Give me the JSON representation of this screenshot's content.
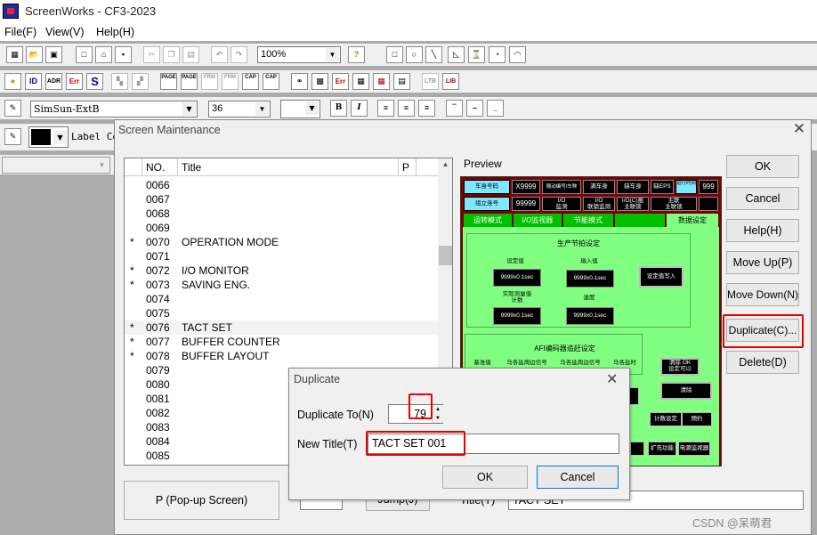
{
  "app": {
    "title": "ScreenWorks - CF3-2023"
  },
  "menu": [
    "File(F)",
    "View(V)",
    "Help(H)"
  ],
  "toolbar": {
    "zoom": "100%",
    "font_name": "SimSun-ExtB",
    "font_size": "36",
    "label_text": "Label Co"
  },
  "toolbar_icons": [
    "PAGE",
    "PAGE",
    "FRM",
    "FRM",
    "CAP",
    "CAP",
    "ADR",
    "Err",
    "S",
    "LTB",
    "LIB",
    "Err"
  ],
  "maintenance": {
    "title": "Screen Maintenance",
    "columns": [
      "NO.",
      "Title",
      "P"
    ],
    "rows": [
      {
        "star": "",
        "no": "0066",
        "title": ""
      },
      {
        "star": "",
        "no": "0067",
        "title": ""
      },
      {
        "star": "",
        "no": "0068",
        "title": ""
      },
      {
        "star": "",
        "no": "0069",
        "title": ""
      },
      {
        "star": "*",
        "no": "0070",
        "title": "OPERATION MODE"
      },
      {
        "star": "",
        "no": "0071",
        "title": ""
      },
      {
        "star": "*",
        "no": "0072",
        "title": "I/O MONITOR"
      },
      {
        "star": "*",
        "no": "0073",
        "title": "SAVING  ENG."
      },
      {
        "star": "",
        "no": "0074",
        "title": ""
      },
      {
        "star": "",
        "no": "0075",
        "title": ""
      },
      {
        "star": "*",
        "no": "0076",
        "title": "TACT SET"
      },
      {
        "star": "*",
        "no": "0077",
        "title": "BUFFER COUNTER"
      },
      {
        "star": "*",
        "no": "0078",
        "title": "BUFFER LAYOUT"
      },
      {
        "star": "",
        "no": "0079",
        "title": ""
      },
      {
        "star": "",
        "no": "0080",
        "title": ""
      },
      {
        "star": "",
        "no": "0081",
        "title": ""
      },
      {
        "star": "",
        "no": "0082",
        "title": ""
      },
      {
        "star": "",
        "no": "0083",
        "title": ""
      },
      {
        "star": "",
        "no": "0084",
        "title": ""
      },
      {
        "star": "",
        "no": "0085",
        "title": ""
      }
    ],
    "preview_label": "Preview",
    "buttons": {
      "ok": "OK",
      "cancel": "Cancel",
      "help": "Help(H)",
      "move_up": "Move Up(P)",
      "move_down": "Move Down(N)",
      "duplicate": "Duplicate(C)...",
      "delete": "Delete(D)"
    },
    "popup_label": "P (Pop-up Screen)",
    "jump_label": "Jump(J)",
    "title_label": "Title(T)",
    "title_value": "TACT SET"
  },
  "preview": {
    "top_cells": [
      "车身号码",
      "X9999",
      "随动编号/车种",
      "满车身",
      "缺车身",
      "缺EPS",
      "运行时间",
      "999"
    ],
    "row2_cells": [
      "组立连号",
      "99999",
      "I/O\n监测",
      "I/O\n联锁监测",
      "I/O(C)报\n主联锁",
      "主联\n主联锁"
    ],
    "tabs": [
      "运转模式",
      "I/O监视器",
      "节能模式",
      "",
      "数据设定"
    ],
    "section1_title": "生产节拍设定",
    "labels": [
      "设定值",
      "输入值",
      "实际测量值\n计数",
      "速度"
    ],
    "values": [
      "9999x0.1sec",
      "9999x0.1sec",
      "9999x0.1sec",
      "9999x0.1sec"
    ],
    "set_btn": "设定值写入",
    "section2_title": "AFI编码器追赶设定",
    "sec2_sub": [
      "基准值",
      "马各延周边信号",
      "马各延周边信号",
      "马各延时"
    ],
    "right_btns": [
      "清除 OK\n设定可以",
      "清除",
      "计数设定",
      "预约",
      "扩充功能",
      "电源监视器"
    ]
  },
  "duplicate": {
    "title": "Duplicate",
    "to_label": "Duplicate To(N)",
    "to_value": "79",
    "newtitle_label": "New Title(T)",
    "newtitle_value": "TACT SET 001",
    "ok": "OK",
    "cancel": "Cancel"
  },
  "watermark": "CSDN @呆萌君"
}
